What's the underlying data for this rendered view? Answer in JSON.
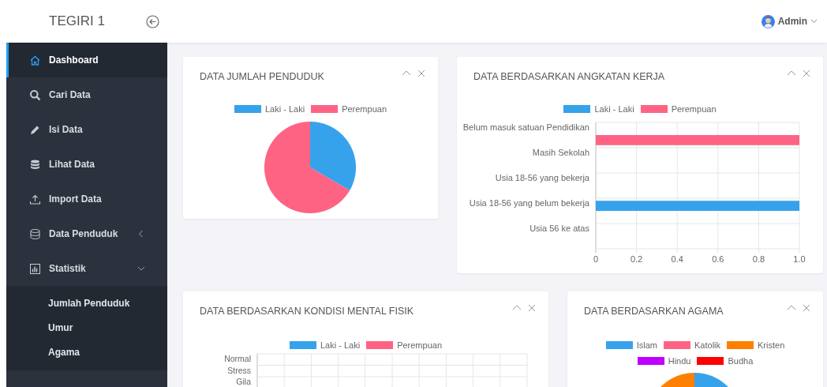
{
  "header": {
    "brand": "TEGIRI 1",
    "user": "Admin"
  },
  "sidebar": {
    "items": [
      {
        "label": "Dashboard",
        "selected": true
      },
      {
        "label": "Cari Data",
        "selected": false
      },
      {
        "label": "Isi Data",
        "selected": false
      },
      {
        "label": "Lihat Data",
        "selected": false
      },
      {
        "label": "Import Data",
        "selected": false
      },
      {
        "label": "Data Penduduk",
        "selected": false,
        "expanded": false
      },
      {
        "label": "Statistik",
        "selected": false,
        "expanded": true,
        "children": [
          {
            "label": "Jumlah Penduduk",
            "selected": false
          },
          {
            "label": "Umur",
            "selected": false
          },
          {
            "label": "Agama",
            "selected": false
          }
        ]
      }
    ]
  },
  "cards": [
    {
      "title": "DATA JUMLAH PENDUDUK",
      "kind": "pie",
      "legend": [
        {
          "label": "Laki - Laki",
          "color": "#36a2eb"
        },
        {
          "label": "Perempuan",
          "color": "#ff6384"
        }
      ]
    },
    {
      "title": "DATA BERDASARKAN ANGKATAN KERJA",
      "kind": "bar",
      "chart_data": {
        "type": "bar",
        "orientation": "horizontal",
        "categories": [
          "Belum masuk satuan Pendidikan",
          "Masih Sekolah",
          "Usia 18-56 yang bekerja",
          "Usia 18-56 yang belum bekerja",
          "Usia 56 ke atas"
        ],
        "series": [
          {
            "name": "Laki - Laki",
            "color": "#36a2eb",
            "values": [
              0,
              0,
              0,
              1,
              0
            ]
          },
          {
            "name": "Perempuan",
            "color": "#ff6384",
            "values": [
              1,
              0,
              0,
              0,
              0
            ]
          }
        ],
        "xlim": [
          0,
          1
        ],
        "grid": true,
        "xticks": [
          {
            "value": 0,
            "label": "0"
          },
          {
            "value": 0.2,
            "label": "0.2"
          },
          {
            "value": 0.4,
            "label": "0.4"
          },
          {
            "value": 0.6,
            "label": "0.6"
          },
          {
            "value": 0.8,
            "label": "0.8"
          },
          {
            "value": 1,
            "label": "1.0"
          }
        ]
      }
    },
    {
      "title": "DATA BERDASARKAN KONDISI MENTAL FISIK",
      "kind": "grid",
      "legend": [
        {
          "label": "Laki - Laki",
          "color": "#36a2eb"
        },
        {
          "label": "Perempuan",
          "color": "#ff6384"
        }
      ],
      "categories": [
        "Normal",
        "Stress",
        "Gila"
      ]
    },
    {
      "title": "DATA BERDASARKAN AGAMA",
      "kind": "pie",
      "legend": [
        {
          "label": "Islam",
          "color": "#36a2eb"
        },
        {
          "label": "Katolik",
          "color": "#ff6384"
        },
        {
          "label": "Kristen",
          "color": "#ff8000"
        },
        {
          "label": "Hindu",
          "color": "#bf00ff"
        },
        {
          "label": "Budha",
          "color": "#ff0000"
        }
      ]
    }
  ]
}
